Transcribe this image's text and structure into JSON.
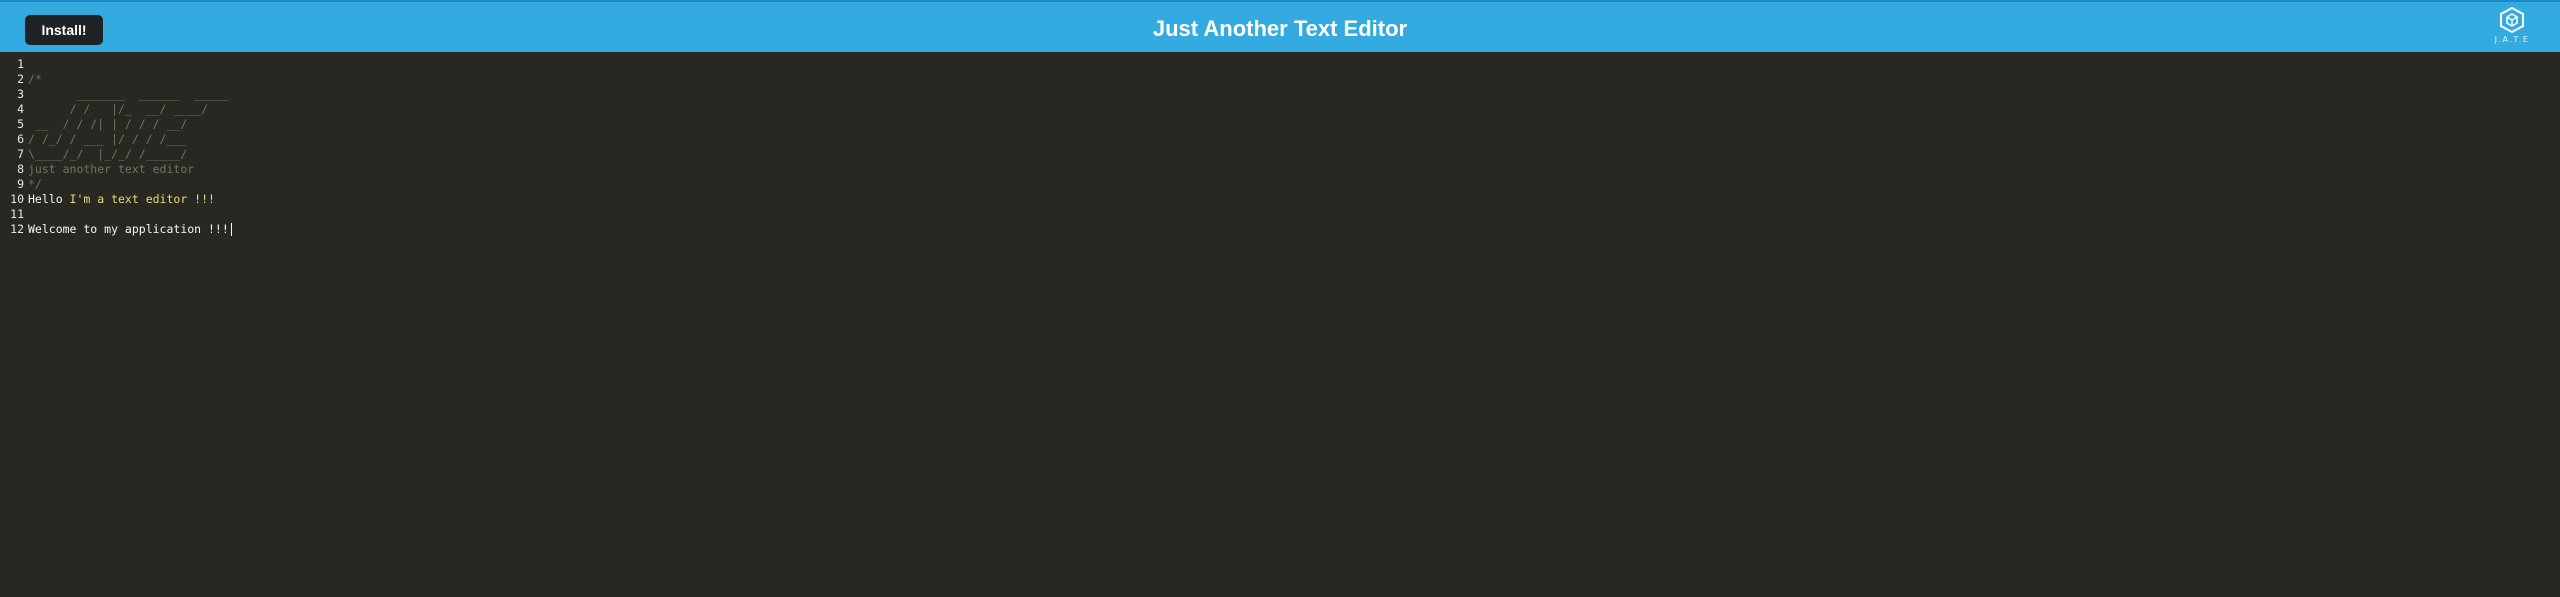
{
  "header": {
    "install_label": "Install!",
    "title": "Just Another Text Editor",
    "logo_text": "J.A.T.E",
    "logo_icon": "cube-icon",
    "bar_color": "#34abe0"
  },
  "editor": {
    "theme_background": "#272822",
    "lines": [
      {
        "num": "1",
        "text": "",
        "style": "plain"
      },
      {
        "num": "2",
        "text": "/*",
        "style": "comment"
      },
      {
        "num": "3",
        "text": "       _______  ______  _____",
        "style": "comment"
      },
      {
        "num": "4",
        "text": "      / /   |/_  __/ ____/",
        "style": "comment"
      },
      {
        "num": "5",
        "text": " __  / / /| | / / / __/",
        "style": "comment"
      },
      {
        "num": "6",
        "text": "/ /_/ / ___ |/ / / /___",
        "style": "comment"
      },
      {
        "num": "7",
        "text": "\\____/_/  |_/_/ /_____/",
        "style": "comment"
      },
      {
        "num": "8",
        "text": "just another text editor",
        "style": "comment"
      },
      {
        "num": "9",
        "text": "*/",
        "style": "comment"
      },
      {
        "num": "10",
        "prefix": "Hello ",
        "text": "I'm a text editor !!!",
        "style": "mixed"
      },
      {
        "num": "11",
        "text": "",
        "style": "plain"
      },
      {
        "num": "12",
        "text": "Welcome to my application !!!",
        "style": "plain",
        "cursor": true
      }
    ]
  }
}
